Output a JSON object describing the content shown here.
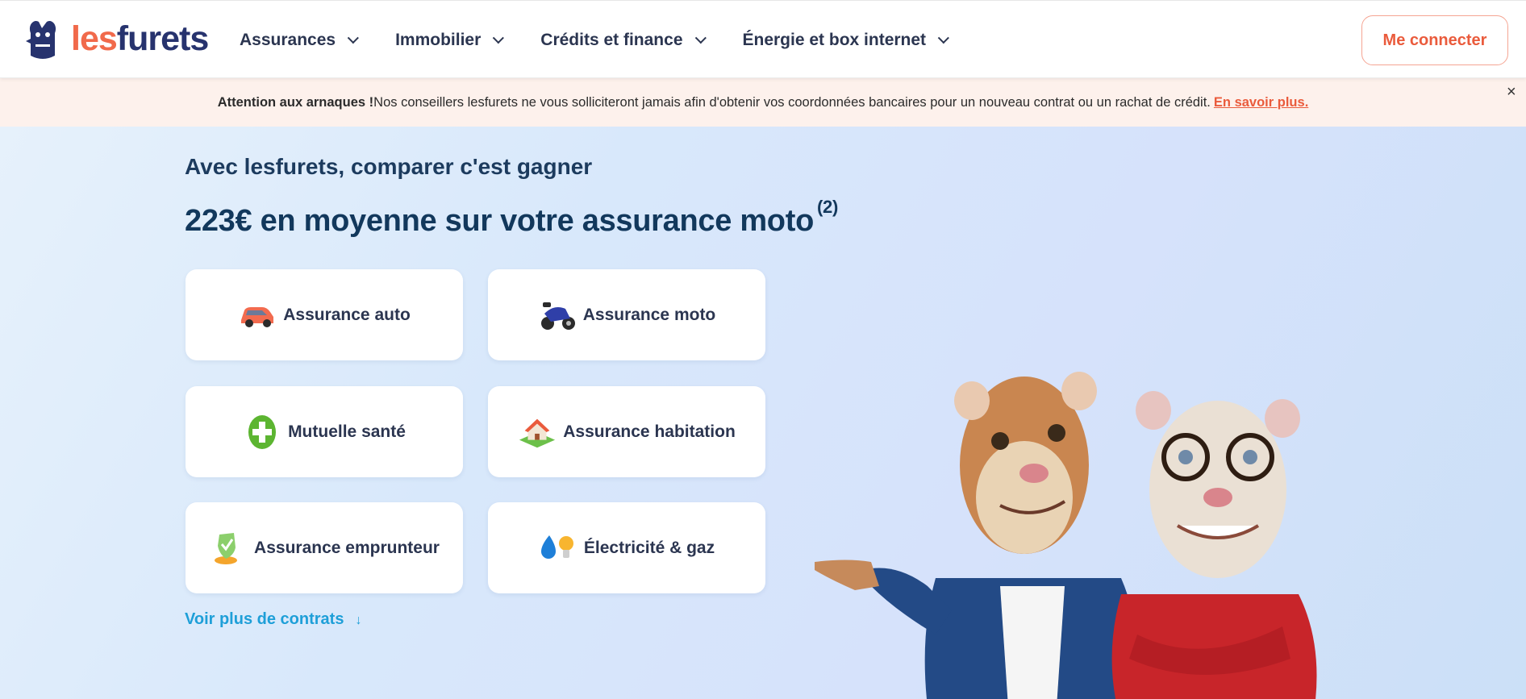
{
  "header": {
    "logo": {
      "part1": "les",
      "part2": "furets"
    },
    "nav": [
      {
        "label": "Assurances"
      },
      {
        "label": "Immobilier"
      },
      {
        "label": "Crédits et finance"
      },
      {
        "label": "Énergie et box internet"
      }
    ],
    "login_label": "Me connecter"
  },
  "alert": {
    "bold": "Attention aux arnaques !",
    "text": " Nos conseillers lesfurets ne vous solliciteront jamais afin d'obtenir vos coordonnées bancaires pour un nouveau contrat ou un rachat de crédit.",
    "link": "En savoir plus.",
    "close": "×"
  },
  "hero": {
    "subtitle": "Avec lesfurets, comparer c'est gagner",
    "headline": "223€ en moyenne sur votre assurance moto",
    "headline_sup": "(2)",
    "cards": [
      {
        "label": "Assurance auto",
        "icon": "car-icon"
      },
      {
        "label": "Assurance moto",
        "icon": "motorbike-icon"
      },
      {
        "label": "Mutuelle santé",
        "icon": "health-cross-icon"
      },
      {
        "label": "Assurance habitation",
        "icon": "house-icon"
      },
      {
        "label": "Assurance emprunteur",
        "icon": "shield-check-icon"
      },
      {
        "label": "Électricité & gaz",
        "icon": "energy-icon"
      }
    ],
    "more_link": "Voir plus de contrats",
    "more_arrow": "↓"
  },
  "colors": {
    "brand_orange": "#ea5b3c",
    "brand_navy": "#27336e",
    "link_blue": "#1e9fd8",
    "alert_bg": "#fdf1ec"
  }
}
